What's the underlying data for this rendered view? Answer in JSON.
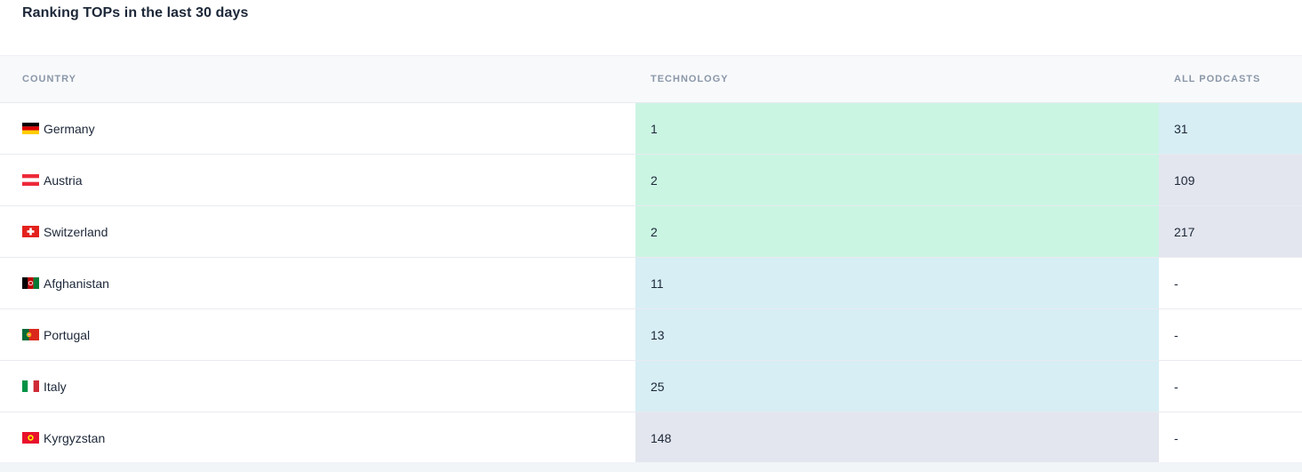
{
  "title": "Ranking TOPs in the last 30 days",
  "columns": {
    "country": "COUNTRY",
    "technology": "TECHNOLOGY",
    "all_podcasts": "ALL PODCASTS"
  },
  "colors": {
    "rank_top": "#cbf5e3",
    "rank_mid": "#d7eef5",
    "rank_low": "#e3e6ee",
    "empty": "#ffffff"
  },
  "rows": [
    {
      "country": "Germany",
      "flag": "germany-flag-icon",
      "technology": "1",
      "technology_tier": "top",
      "all_podcasts": "31",
      "all_tier": "mid"
    },
    {
      "country": "Austria",
      "flag": "austria-flag-icon",
      "technology": "2",
      "technology_tier": "top",
      "all_podcasts": "109",
      "all_tier": "low"
    },
    {
      "country": "Switzerland",
      "flag": "switzerland-flag-icon",
      "technology": "2",
      "technology_tier": "top",
      "all_podcasts": "217",
      "all_tier": "low"
    },
    {
      "country": "Afghanistan",
      "flag": "afghanistan-flag-icon",
      "technology": "11",
      "technology_tier": "mid",
      "all_podcasts": "-",
      "all_tier": "empty"
    },
    {
      "country": "Portugal",
      "flag": "portugal-flag-icon",
      "technology": "13",
      "technology_tier": "mid",
      "all_podcasts": "-",
      "all_tier": "empty"
    },
    {
      "country": "Italy",
      "flag": "italy-flag-icon",
      "technology": "25",
      "technology_tier": "mid",
      "all_podcasts": "-",
      "all_tier": "empty"
    },
    {
      "country": "Kyrgyzstan",
      "flag": "kyrgyzstan-flag-icon",
      "technology": "148",
      "technology_tier": "low",
      "all_podcasts": "-",
      "all_tier": "empty"
    }
  ]
}
